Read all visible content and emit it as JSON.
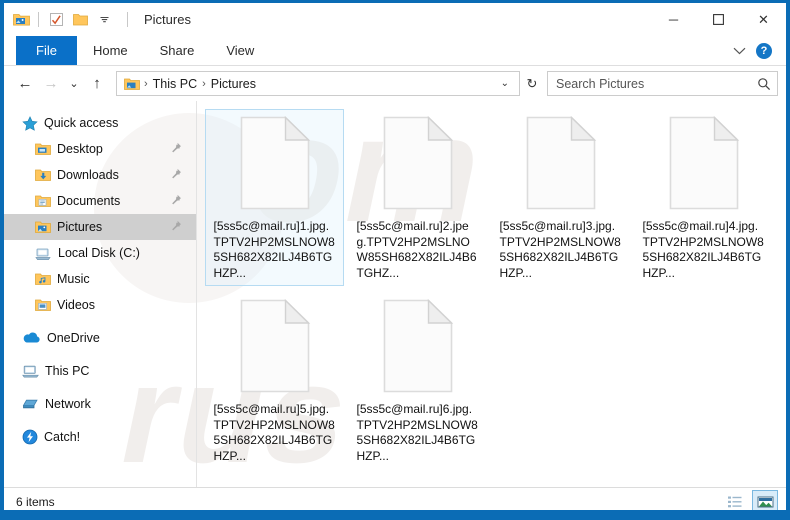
{
  "window": {
    "title": "Pictures",
    "accent_color": "#0b6cb5",
    "file_tab_color": "#0a70c8"
  },
  "quick_access_toolbar": {
    "items": [
      {
        "name": "pictures-folder-icon",
        "label": "Pictures"
      },
      {
        "name": "properties-icon",
        "label": "Properties"
      },
      {
        "name": "new-folder-icon",
        "label": "New folder"
      }
    ],
    "customize_label": "Customize Quick Access Toolbar"
  },
  "window_controls": {
    "minimize": "─",
    "maximize": "☐",
    "close": "✕"
  },
  "ribbon": {
    "tabs": [
      {
        "label": "File",
        "active": true
      },
      {
        "label": "Home",
        "active": false
      },
      {
        "label": "Share",
        "active": false
      },
      {
        "label": "View",
        "active": false
      }
    ],
    "collapse_icon": "⌄",
    "help_label": "?"
  },
  "address_bar": {
    "back_label": "←",
    "forward_label": "→",
    "recent_label": "⌄",
    "up_label": "↑",
    "breadcrumbs": [
      "This PC",
      "Pictures"
    ],
    "separator": "›",
    "dropdown_icon": "⌄",
    "refresh_icon": "↻"
  },
  "search": {
    "placeholder": "Search Pictures",
    "value": "",
    "icon": "search-icon"
  },
  "sidebar": {
    "items": [
      {
        "label": "Quick access",
        "icon": "star-icon",
        "indent": false,
        "pinned": false,
        "selected": false,
        "group": false
      },
      {
        "label": "Desktop",
        "icon": "folder-desktop-icon",
        "indent": true,
        "pinned": true,
        "selected": false,
        "group": false
      },
      {
        "label": "Downloads",
        "icon": "folder-downloads-icon",
        "indent": true,
        "pinned": true,
        "selected": false,
        "group": false
      },
      {
        "label": "Documents",
        "icon": "folder-documents-icon",
        "indent": true,
        "pinned": true,
        "selected": false,
        "group": false
      },
      {
        "label": "Pictures",
        "icon": "folder-pictures-icon",
        "indent": true,
        "pinned": true,
        "selected": true,
        "group": false
      },
      {
        "label": "Local Disk (C:)",
        "icon": "disk-icon",
        "indent": true,
        "pinned": false,
        "selected": false,
        "group": false
      },
      {
        "label": "Music",
        "icon": "folder-music-icon",
        "indent": true,
        "pinned": false,
        "selected": false,
        "group": false
      },
      {
        "label": "Videos",
        "icon": "folder-videos-icon",
        "indent": true,
        "pinned": false,
        "selected": false,
        "group": false
      },
      {
        "label": "OneDrive",
        "icon": "onedrive-cloud-icon",
        "indent": false,
        "pinned": false,
        "selected": false,
        "group": true
      },
      {
        "label": "This PC",
        "icon": "this-pc-icon",
        "indent": false,
        "pinned": false,
        "selected": false,
        "group": true
      },
      {
        "label": "Network",
        "icon": "network-icon",
        "indent": false,
        "pinned": false,
        "selected": false,
        "group": true
      },
      {
        "label": "Catch!",
        "icon": "catch-icon",
        "indent": false,
        "pinned": false,
        "selected": false,
        "group": true
      }
    ],
    "pin_glyph": "📌"
  },
  "files": [
    {
      "name": "[5ss5c@mail.ru]1.jpg.TPTV2HP2MSLNOW85SH682X82ILJ4B6TGHZP...",
      "icon": "blank-document-icon",
      "selected": true
    },
    {
      "name": "[5ss5c@mail.ru]2.jpeg.TPTV2HP2MSLNOW85SH682X82ILJ4B6TGHZ...",
      "icon": "blank-document-icon",
      "selected": false
    },
    {
      "name": "[5ss5c@mail.ru]3.jpg.TPTV2HP2MSLNOW85SH682X82ILJ4B6TGHZP...",
      "icon": "blank-document-icon",
      "selected": false
    },
    {
      "name": "[5ss5c@mail.ru]4.jpg.TPTV2HP2MSLNOW85SH682X82ILJ4B6TGHZP...",
      "icon": "blank-document-icon",
      "selected": false
    },
    {
      "name": "[5ss5c@mail.ru]5.jpg.TPTV2HP2MSLNOW85SH682X82ILJ4B6TGHZP...",
      "icon": "blank-document-icon",
      "selected": false
    },
    {
      "name": "[5ss5c@mail.ru]6.jpg.TPTV2HP2MSLNOW85SH682X82ILJ4B6TGHZP...",
      "icon": "blank-document-icon",
      "selected": false
    }
  ],
  "status_bar": {
    "item_count_text": "6 items",
    "views": [
      {
        "name": "details-view-button",
        "active": false
      },
      {
        "name": "large-icons-view-button",
        "active": true
      }
    ]
  },
  "watermark": {
    "line1": "om",
    "line2": "rus"
  }
}
